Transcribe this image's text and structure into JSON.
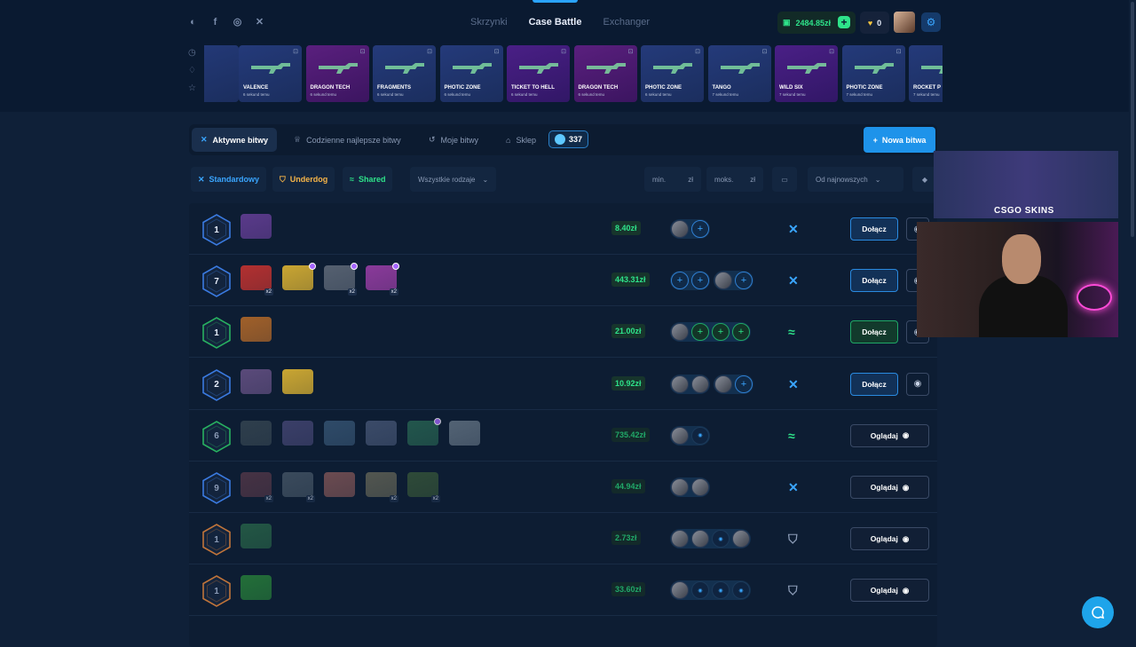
{
  "nav": {
    "tabs": [
      {
        "label": "Skrzynki"
      },
      {
        "label": "Case Battle"
      },
      {
        "label": "Exchanger"
      }
    ],
    "active": "Case Battle"
  },
  "header": {
    "balance": "2484.85zł",
    "coins": "0"
  },
  "social": [
    "discord-icon",
    "facebook-icon",
    "instagram-icon",
    "x-icon"
  ],
  "drops": [
    {
      "name": "VALENCE",
      "sub": "6 sekund temu",
      "palette": "blue"
    },
    {
      "name": "DRAGON TECH",
      "sub": "6 sekund temu",
      "palette": "pink"
    },
    {
      "name": "FRAGMENTS",
      "sub": "6 sekund temu",
      "palette": "blue"
    },
    {
      "name": "PHOTIC ZONE",
      "sub": "6 sekund temu",
      "palette": "blue"
    },
    {
      "name": "TICKET TO HELL",
      "sub": "6 sekund temu",
      "palette": "purple"
    },
    {
      "name": "DRAGON TECH",
      "sub": "6 sekund temu",
      "palette": "pink"
    },
    {
      "name": "PHOTIC ZONE",
      "sub": "6 sekund temu",
      "palette": "blue"
    },
    {
      "name": "TANGO",
      "sub": "7 sekund temu",
      "palette": "blue"
    },
    {
      "name": "WILD SIX",
      "sub": "7 sekund temu",
      "palette": "purple"
    },
    {
      "name": "PHOTIC ZONE",
      "sub": "7 sekund temu",
      "palette": "blue"
    },
    {
      "name": "ROCKET P",
      "sub": "7 sekund temu",
      "palette": "blue"
    }
  ],
  "battleTabs": {
    "active": "Aktywne bitwy",
    "daily": "Codzienne najlepsze bitwy",
    "mine": "Moje bitwy",
    "shop": "Sklep",
    "count": "337",
    "newBattle": "Nowa bitwa"
  },
  "filters": {
    "standard": "Standardowy",
    "underdog": "Underdog",
    "shared": "Shared",
    "allTypes": "Wszystkie rodzaje",
    "min": "min.",
    "max": "moks.",
    "currency": "zł",
    "sort": "Od najnowszych"
  },
  "labels": {
    "join": "Dołącz",
    "watch": "Oglądaj"
  },
  "battles": [
    {
      "rounds": "1",
      "price": "8.40zł",
      "mode": "standard",
      "action": "join",
      "tier": "blue",
      "cases": [
        {
          "c": "#5a3a8a"
        }
      ],
      "players": [
        [
          "p",
          "s"
        ]
      ]
    },
    {
      "rounds": "7",
      "price": "443.31zł",
      "mode": "standard",
      "action": "join",
      "tier": "blue",
      "cases": [
        {
          "c": "#b23030",
          "m": "x2"
        },
        {
          "c": "#c9a532",
          "d": 1
        },
        {
          "c": "#556070",
          "m": "x2",
          "d": 1
        },
        {
          "c": "#8a3a9a",
          "m": "x2",
          "d": 1
        }
      ],
      "players": [
        [
          "s",
          "s"
        ],
        [
          "p",
          "s"
        ]
      ]
    },
    {
      "rounds": "1",
      "price": "21.00zł",
      "mode": "shared",
      "action": "join",
      "tier": "green",
      "cases": [
        {
          "c": "#a0602a"
        }
      ],
      "players": [
        [
          "p",
          "g",
          "g",
          "g"
        ]
      ]
    },
    {
      "rounds": "2",
      "price": "10.92zł",
      "mode": "standard",
      "action": "join",
      "tier": "blue",
      "cases": [
        {
          "c": "#5a4a7a"
        },
        {
          "c": "#c9a532"
        }
      ],
      "players": [
        [
          "p",
          "p"
        ],
        [
          "p",
          "s"
        ]
      ]
    },
    {
      "rounds": "6",
      "price": "735.42zł",
      "mode": "shared",
      "action": "watch",
      "tier": "green",
      "cases": [
        {
          "c": "#3a4a55"
        },
        {
          "c": "#4a4a7a"
        },
        {
          "c": "#3a5a7a"
        },
        {
          "c": "#4a5a7a"
        },
        {
          "c": "#2a6a55",
          "d": 1
        },
        {
          "c": "#6a7a8a"
        }
      ],
      "players": [
        [
          "p",
          "d"
        ]
      ]
    },
    {
      "rounds": "9",
      "price": "44.94zł",
      "mode": "standard",
      "action": "watch",
      "tier": "blue",
      "cases": [
        {
          "c": "#5a3a4a",
          "m": "x2"
        },
        {
          "c": "#4a5a6a",
          "m": "x2"
        },
        {
          "c": "#8a5a5a"
        },
        {
          "c": "#6a6a5a",
          "m": "x2"
        },
        {
          "c": "#3a5a3a",
          "m": "x2"
        }
      ],
      "players": [
        [
          "p",
          "p"
        ]
      ]
    },
    {
      "rounds": "1",
      "price": "2.73zł",
      "mode": "underdog",
      "action": "watch",
      "tier": "orange",
      "cases": [
        {
          "c": "#2a6a4a"
        }
      ],
      "players": [
        [
          "p",
          "p",
          "d",
          "p"
        ]
      ]
    },
    {
      "rounds": "1",
      "price": "33.60zł",
      "mode": "underdog",
      "action": "watch",
      "tier": "orange",
      "cases": [
        {
          "c": "#2a8a3a"
        }
      ],
      "players": [
        [
          "p",
          "d",
          "d",
          "d"
        ]
      ]
    }
  ],
  "stream": {
    "brand": "CSGO SKINS"
  },
  "colors": {
    "accent": "#1e93ea",
    "green": "#2ee38a",
    "gold": "#f7c640",
    "bg": "#0f2038"
  }
}
